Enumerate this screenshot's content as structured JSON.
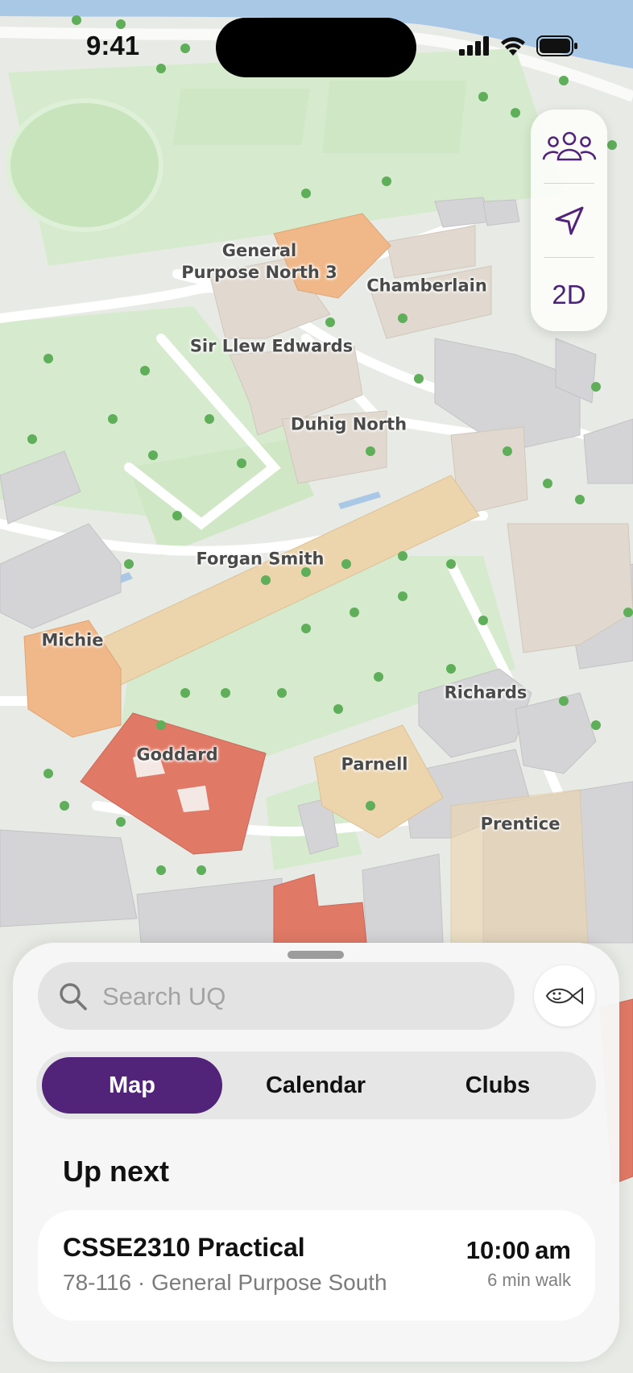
{
  "status_bar": {
    "time": "9:41"
  },
  "map": {
    "labels": {
      "general_purpose_north_3": "General\nPurpose North 3",
      "chamberlain": "Chamberlain",
      "sir_llew_edwards": "Sir Llew Edwards",
      "duhig_north": "Duhig North",
      "forgan_smith": "Forgan Smith",
      "michie": "Michie",
      "richards": "Richards",
      "goddard": "Goddard",
      "parnell": "Parnell",
      "prentice": "Prentice"
    },
    "controls": {
      "friends_icon": "people-icon",
      "locate_icon": "location-arrow-icon",
      "view_mode": "2D"
    }
  },
  "sheet": {
    "search": {
      "placeholder": "Search UQ",
      "value": ""
    },
    "avatar_icon": "fish-smiley-icon",
    "tabs": [
      {
        "label": "Map",
        "active": true
      },
      {
        "label": "Calendar",
        "active": false
      },
      {
        "label": "Clubs",
        "active": false
      }
    ],
    "up_next_heading": "Up next",
    "event": {
      "title": "CSSE2310 Practical",
      "location": "78-116 · General Purpose South",
      "time": "10:00 am",
      "walk": "6 min walk"
    }
  },
  "colors": {
    "accent": "#51247a",
    "goddard": "#e07a66",
    "orange_building": "#f0b888",
    "water": "#a9c8e6",
    "grass": "#d6ebcd"
  }
}
